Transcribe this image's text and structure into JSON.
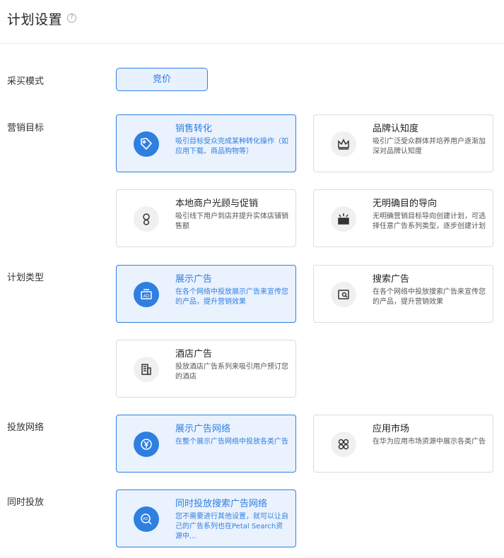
{
  "header": {
    "title": "计划设置",
    "help": "?"
  },
  "labels": {
    "purchase_mode": "采买模式",
    "marketing_goal": "营销目标",
    "plan_type": "计划类型",
    "network": "投放网络",
    "simultaneous": "同时投放"
  },
  "purchase_mode": {
    "value": "竞价"
  },
  "marketing_goals": [
    {
      "title": "销售转化",
      "desc": "吸引目标受众完成某种转化操作（如应用下载、商品购物等）",
      "icon": "tag-icon"
    },
    {
      "title": "品牌认知度",
      "desc": "吸引广泛受众群体并培养用户逐渐加深对品牌认知度",
      "icon": "crown-icon"
    },
    {
      "title": "本地商户光顾与促销",
      "desc": "吸引线下用户到店并提升实体店铺销售额",
      "icon": "location-icon"
    },
    {
      "title": "无明确目的导向",
      "desc": "无明确营销目标导向创建计划，可选择任意广告系列类型，逐步创建计划",
      "icon": "box-icon"
    }
  ],
  "plan_types": [
    {
      "title": "展示广告",
      "desc": "在各个网络中投放展示广告来宣传您的产品，提升营销效果",
      "icon": "ad-icon"
    },
    {
      "title": "搜索广告",
      "desc": "在各个网络中投放搜索广告来宣传您的产品，提升营销效果",
      "icon": "search-ad-icon"
    },
    {
      "title": "酒店广告",
      "desc": "投放酒店广告系列来吸引用户预订您的酒店",
      "icon": "hotel-icon"
    }
  ],
  "networks": [
    {
      "title": "展示广告网络",
      "desc": "在整个展示广告网络中投放各类广告",
      "icon": "yen-icon"
    },
    {
      "title": "应用市场",
      "desc": "在华为应用市场资源中展示各类广告",
      "icon": "apps-icon"
    }
  ],
  "simultaneous": [
    {
      "title": "同时投放搜索广告网络",
      "desc": "您不需要进行其他设置，就可以让自己的广告系列也在Petal Search资源中...",
      "icon": "search-ad-icon"
    }
  ]
}
